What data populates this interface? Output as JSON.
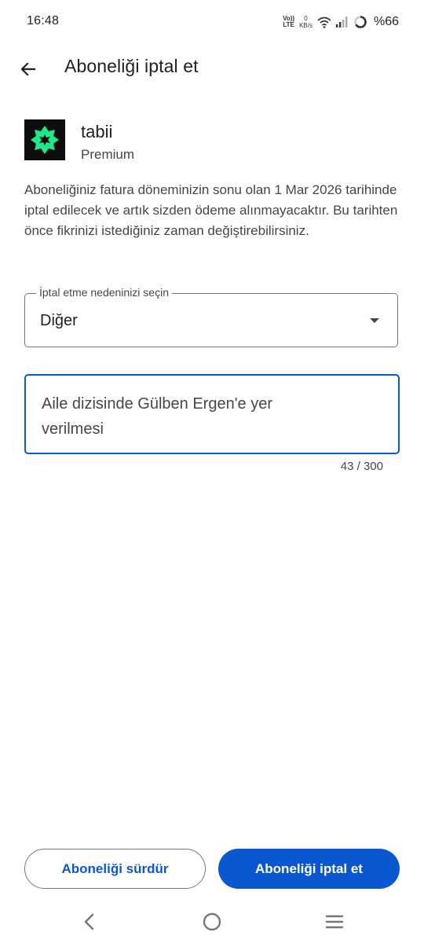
{
  "status_bar": {
    "time": "16:48",
    "volte_line1": "Vo))",
    "volte_line2": "LTE",
    "data_speed_value": "0",
    "data_speed_unit": "KB/s",
    "battery": "%66",
    "icons": [
      "volte-icon",
      "wifi-icon",
      "signal-icon",
      "battery-ring-icon"
    ]
  },
  "header": {
    "back_icon": "arrow-back-icon",
    "title": "Aboneliği iptal et"
  },
  "app": {
    "name": "tabii",
    "plan": "Premium",
    "logo_color": "#1ee88a",
    "logo_bg": "#0c0c0c"
  },
  "description": "Aboneliğiniz fatura döneminizin sonu olan 1 Mar 2026 tarihinde iptal edilecek ve artık sizden ödeme alınmayacaktır. Bu tarihten önce fikrinizi istediğiniz zaman değiştirebilirsiniz.",
  "reason_select": {
    "label": "İptal etme nedeninizi seçin",
    "value": "Diğer"
  },
  "reason_text": {
    "value": "Aile dizisinde Gülben Ergen'e yer verilmesi",
    "counter": "43 / 300"
  },
  "buttons": {
    "keep": "Aboneliği sürdür",
    "cancel": "Aboneliği iptal et"
  },
  "nav_bar": {
    "icons": [
      "back-nav-icon",
      "home-nav-icon",
      "recents-menu-icon"
    ]
  },
  "colors": {
    "accent": "#0b57d0",
    "text_primary": "#1f1f1f",
    "text_secondary": "#444746",
    "outline": "#747775"
  }
}
